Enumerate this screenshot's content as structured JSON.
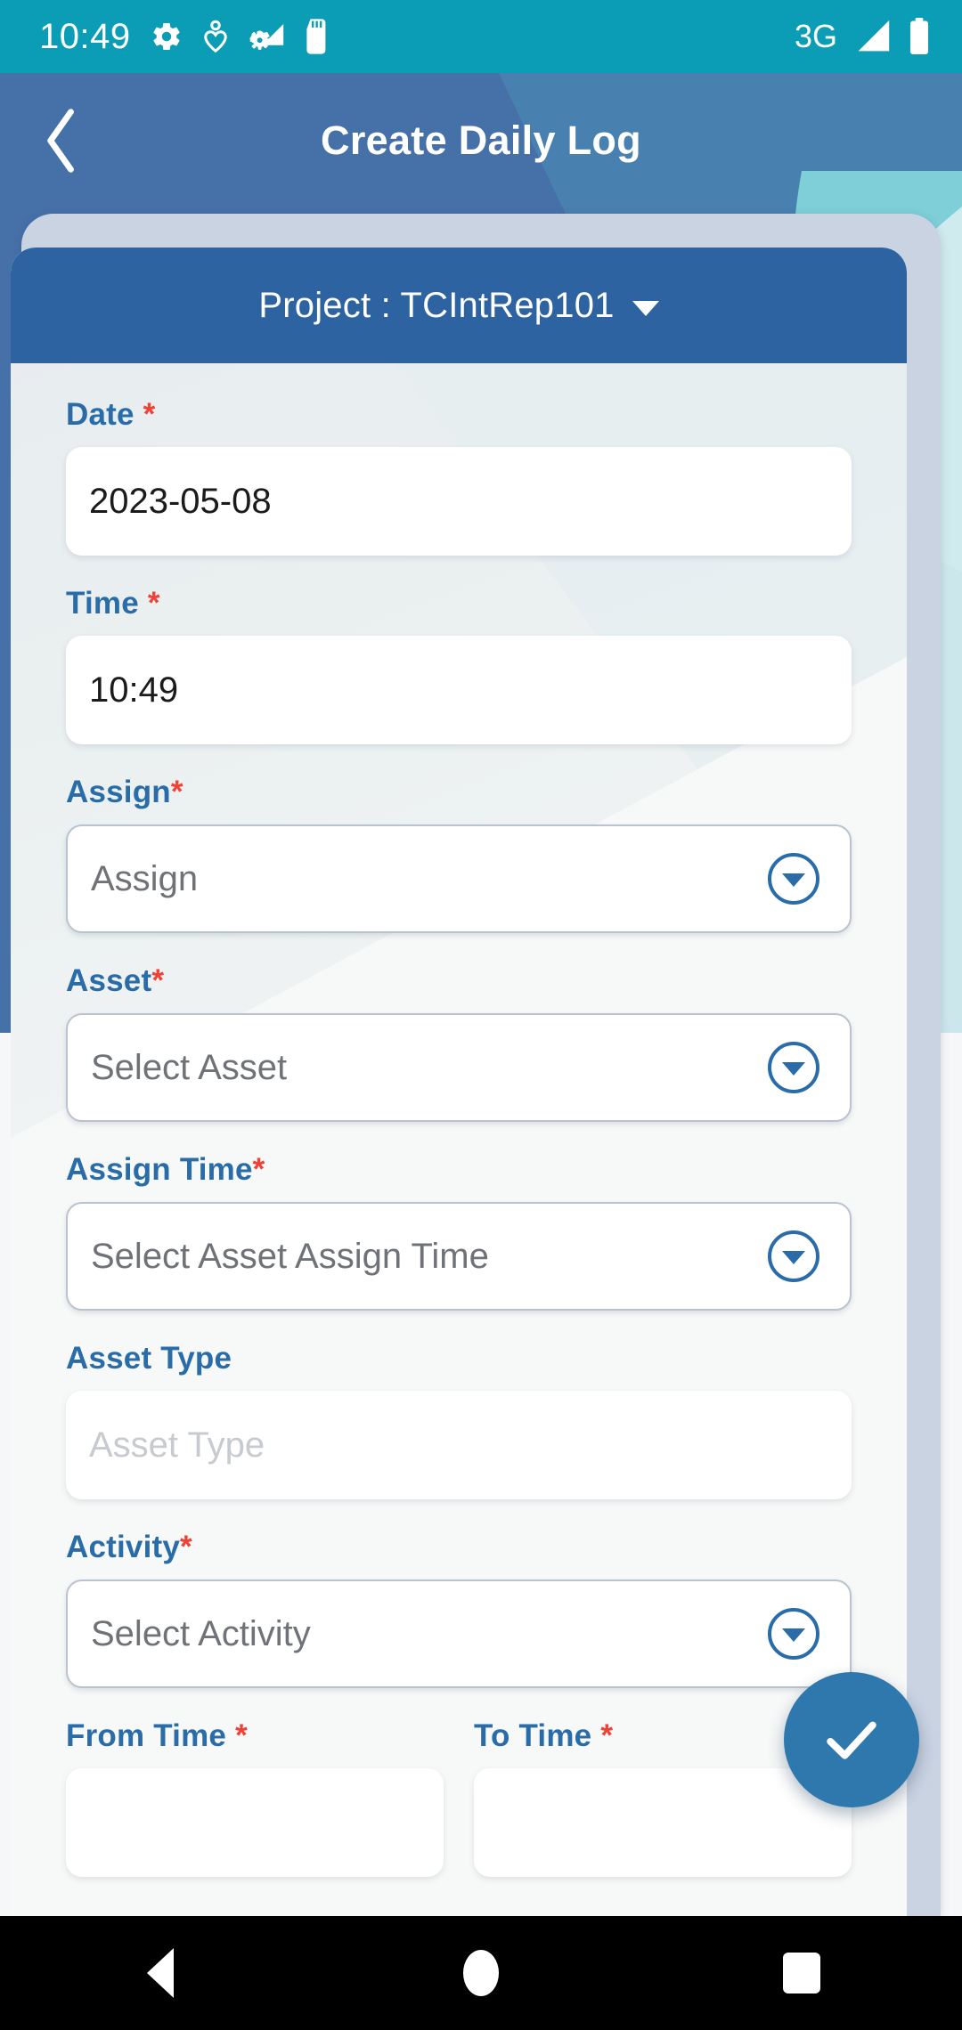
{
  "status_bar": {
    "time": "10:49",
    "network": "3G",
    "left_icons": [
      "gear-icon",
      "heart-location-icon",
      "wifi-settings-icon",
      "sd-card-icon"
    ],
    "right_icons": [
      "signal-icon",
      "battery-icon"
    ],
    "background_color": "#0b9db5"
  },
  "app_bar": {
    "back_icon": "chevron-left-icon",
    "title": "Create Daily Log",
    "background_color": "#4670a8"
  },
  "project_bar": {
    "label": "Project : TCIntRep101",
    "dropdown_icon": "caret-down-icon",
    "background_color": "#2c63a0"
  },
  "form": {
    "fields": [
      {
        "key": "date",
        "label": "Date",
        "required": true,
        "required_spaced": true,
        "value": "2023-05-08",
        "placeholder": "",
        "type": "text",
        "has_dropdown": false
      },
      {
        "key": "time",
        "label": "Time",
        "required": true,
        "required_spaced": true,
        "value": "10:49",
        "placeholder": "",
        "type": "text",
        "has_dropdown": false
      },
      {
        "key": "assign",
        "label": "Assign",
        "required": true,
        "required_spaced": false,
        "value": "",
        "placeholder": "Assign",
        "type": "select",
        "has_dropdown": true
      },
      {
        "key": "asset",
        "label": "Asset",
        "required": true,
        "required_spaced": false,
        "value": "",
        "placeholder": "Select Asset",
        "type": "select",
        "has_dropdown": true
      },
      {
        "key": "assign_time",
        "label": "Assign Time",
        "required": true,
        "required_spaced": false,
        "value": "",
        "placeholder": "Select Asset Assign Time",
        "type": "select",
        "has_dropdown": true
      },
      {
        "key": "asset_type",
        "label": "Asset Type",
        "required": false,
        "required_spaced": false,
        "value": "",
        "placeholder": "Asset Type",
        "type": "text",
        "has_dropdown": false,
        "disabled": true
      },
      {
        "key": "activity",
        "label": "Activity",
        "required": true,
        "required_spaced": false,
        "value": "",
        "placeholder": "Select Activity",
        "type": "select",
        "has_dropdown": true
      }
    ],
    "time_range": [
      {
        "key": "from_time",
        "label": "From Time",
        "required": true,
        "required_spaced": true,
        "value": "",
        "placeholder": ""
      },
      {
        "key": "to_time",
        "label": "To Time",
        "required": true,
        "required_spaced": true,
        "value": "",
        "placeholder": ""
      }
    ],
    "required_marker": "*",
    "label_color": "#2a6ca8",
    "required_color": "#ef4135"
  },
  "fab": {
    "icon": "check-icon",
    "color": "#2e78ae"
  },
  "nav_bar": {
    "items": [
      "back-triangle-icon",
      "home-circle-icon",
      "recents-square-icon"
    ],
    "background_color": "#000000"
  }
}
